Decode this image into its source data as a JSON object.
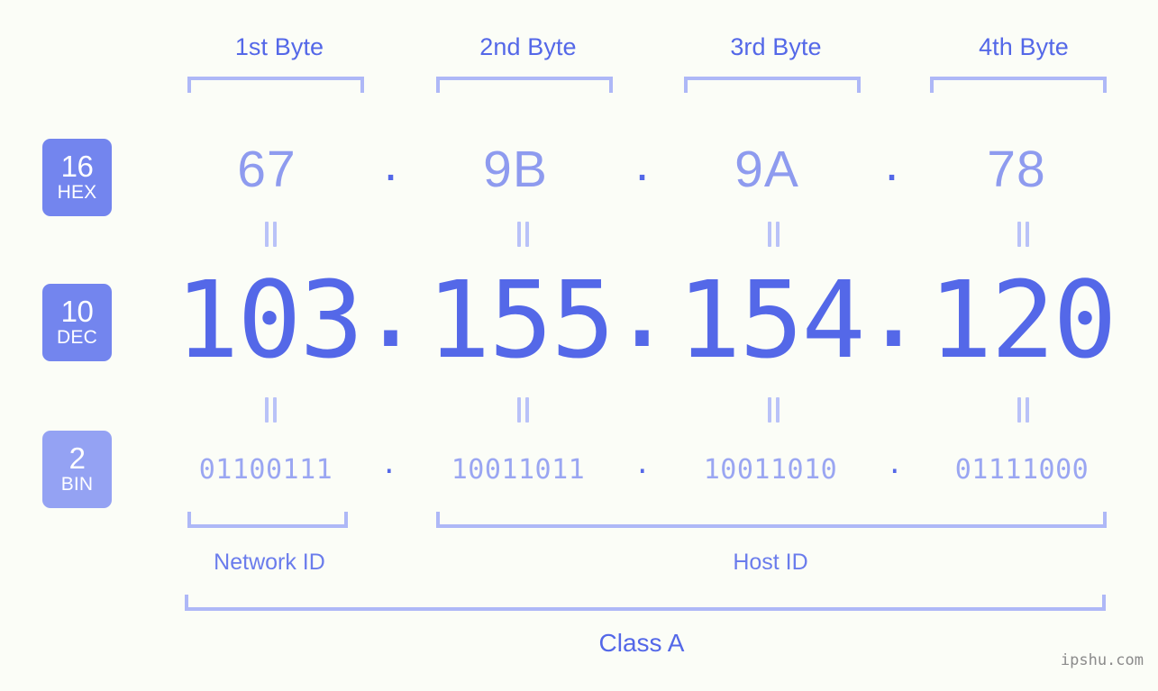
{
  "meta": {
    "background_color": "#fbfdf7",
    "accent_strong": "#5468e8",
    "accent_light": "#8e9bef",
    "bracket_color": "#aeb8f7",
    "badge_color": "#7385ee",
    "badge_color_light": "#94a2f3"
  },
  "byte_headers": [
    {
      "label": "1st Byte"
    },
    {
      "label": "2nd Byte"
    },
    {
      "label": "3rd Byte"
    },
    {
      "label": "4th Byte"
    }
  ],
  "bases": [
    {
      "number": "16",
      "name": "HEX"
    },
    {
      "number": "10",
      "name": "DEC"
    },
    {
      "number": "2",
      "name": "BIN"
    }
  ],
  "rows": {
    "hex": {
      "base_number": "16",
      "base_name": "HEX",
      "values": [
        "67",
        "9B",
        "9A",
        "78"
      ],
      "separator": "."
    },
    "dec": {
      "base_number": "10",
      "base_name": "DEC",
      "values": [
        "103",
        "155",
        "154",
        "120"
      ],
      "separator": "."
    },
    "bin": {
      "base_number": "2",
      "base_name": "BIN",
      "values": [
        "01100111",
        "10011011",
        "10011010",
        "01111000"
      ],
      "separator": "."
    }
  },
  "separators": {
    "dot": ".",
    "equals_mark": "||"
  },
  "segments": {
    "network_id": "Network ID",
    "host_id": "Host ID",
    "class": "Class A"
  },
  "watermark": "ipshu.com"
}
